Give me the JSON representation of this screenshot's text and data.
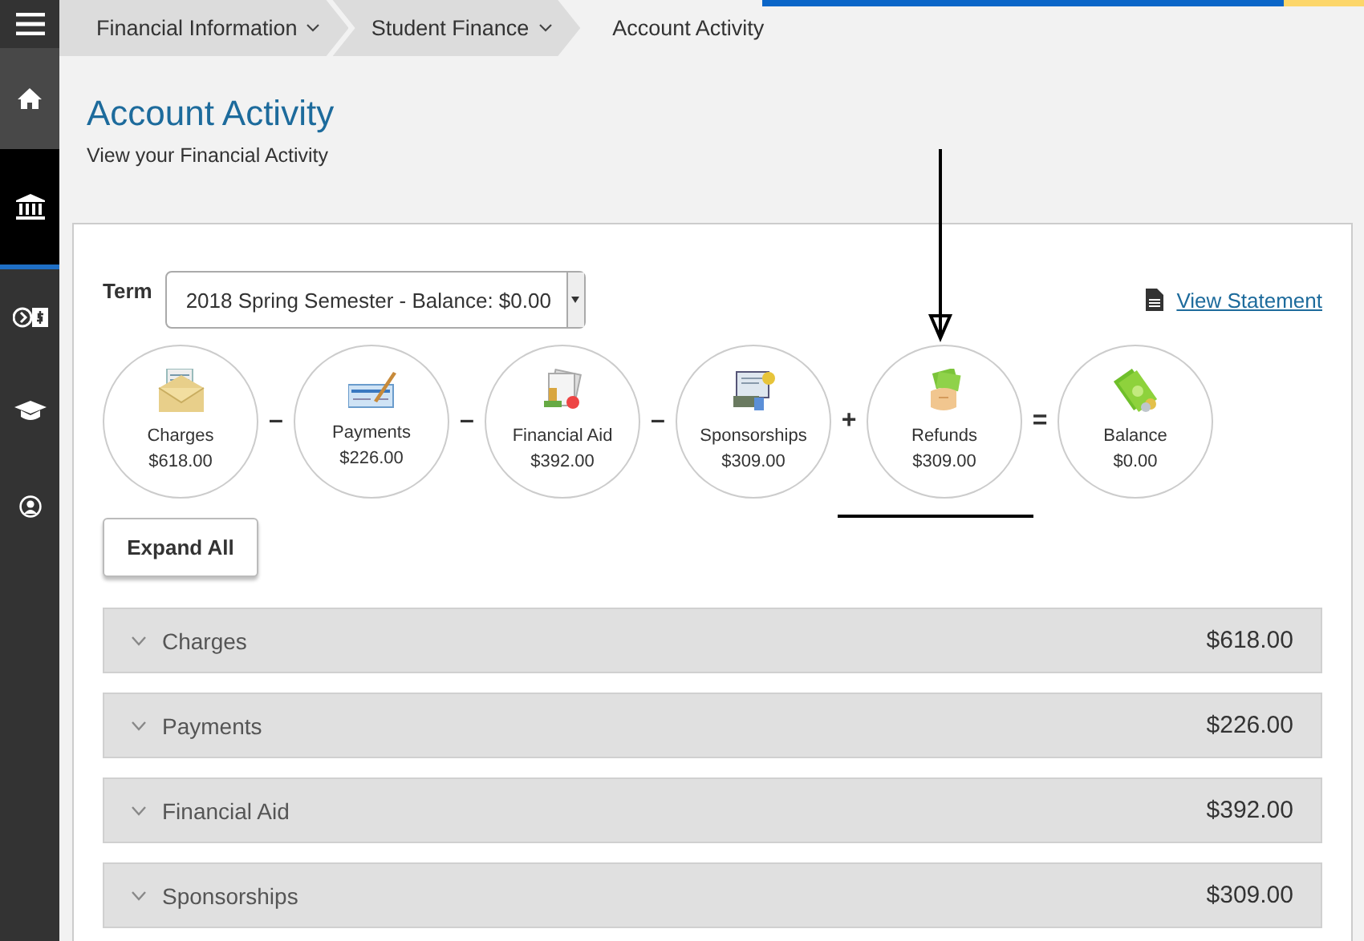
{
  "sidebar": {
    "items": [
      {
        "selected": false
      },
      {
        "selected": false
      },
      {
        "selected": true
      },
      {
        "selected": false
      },
      {
        "selected": false
      },
      {
        "selected": false
      }
    ]
  },
  "breadcrumbs": [
    {
      "label": "Financial Information",
      "dropdown": true
    },
    {
      "label": "Student Finance",
      "dropdown": true
    },
    {
      "label": "Account Activity",
      "dropdown": false
    }
  ],
  "page": {
    "title": "Account Activity",
    "subtitle": "View your Financial Activity"
  },
  "term": {
    "label": "Term",
    "value": "2018 Spring Semester - Balance: $0.00"
  },
  "view_statement": "View Statement",
  "summary": [
    {
      "label": "Charges",
      "amount": "$618.00",
      "operator": "–"
    },
    {
      "label": "Payments",
      "amount": "$226.00",
      "operator": "–"
    },
    {
      "label": "Financial Aid",
      "amount": "$392.00",
      "operator": "–"
    },
    {
      "label": "Sponsorships",
      "amount": "$309.00",
      "operator": "+"
    },
    {
      "label": "Refunds",
      "amount": "$309.00",
      "operator": "="
    },
    {
      "label": "Balance",
      "amount": "$0.00"
    }
  ],
  "expand_all": "Expand All",
  "sections": [
    {
      "label": "Charges",
      "amount": "$618.00",
      "expanded": false
    },
    {
      "label": "Payments",
      "amount": "$226.00",
      "expanded": false
    },
    {
      "label": "Financial Aid",
      "amount": "$392.00",
      "expanded": false
    },
    {
      "label": "Sponsorships",
      "amount": "$309.00",
      "expanded": false
    }
  ]
}
